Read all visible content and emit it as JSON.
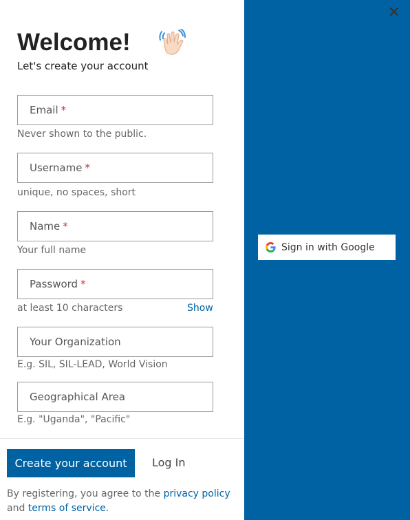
{
  "close_label": "✕",
  "header": {
    "title": "Welcome!",
    "subtitle": "Let's create your account",
    "wave_icon": "waving-hand"
  },
  "fields": [
    {
      "placeholder": "Email",
      "required": "*",
      "help": "Never shown to the public."
    },
    {
      "placeholder": "Username",
      "required": "*",
      "help": "unique, no spaces, short"
    },
    {
      "placeholder": "Name",
      "required": "*",
      "help": "Your full name"
    },
    {
      "placeholder": "Password",
      "required": "*",
      "help": "at least 10 characters",
      "show_label": "Show"
    },
    {
      "placeholder": "Your Organization",
      "required": "",
      "help": "E.g. SIL, SIL-LEAD, World Vision"
    },
    {
      "placeholder": "Geographical Area",
      "required": "",
      "help": "E.g. \"Uganda\", \"Pacific\""
    }
  ],
  "actions": {
    "create_label": "Create your account",
    "login_label": "Log In"
  },
  "terms": {
    "prefix": "By registering, you agree to the ",
    "privacy_label": "privacy policy",
    "and": "and ",
    "tos_label": "terms of service",
    "suffix": "."
  },
  "google": {
    "label": "Sign in with Google",
    "icon": "google-g-logo"
  },
  "colors": {
    "brand": "#0062a3",
    "required": "#d32f2f"
  }
}
